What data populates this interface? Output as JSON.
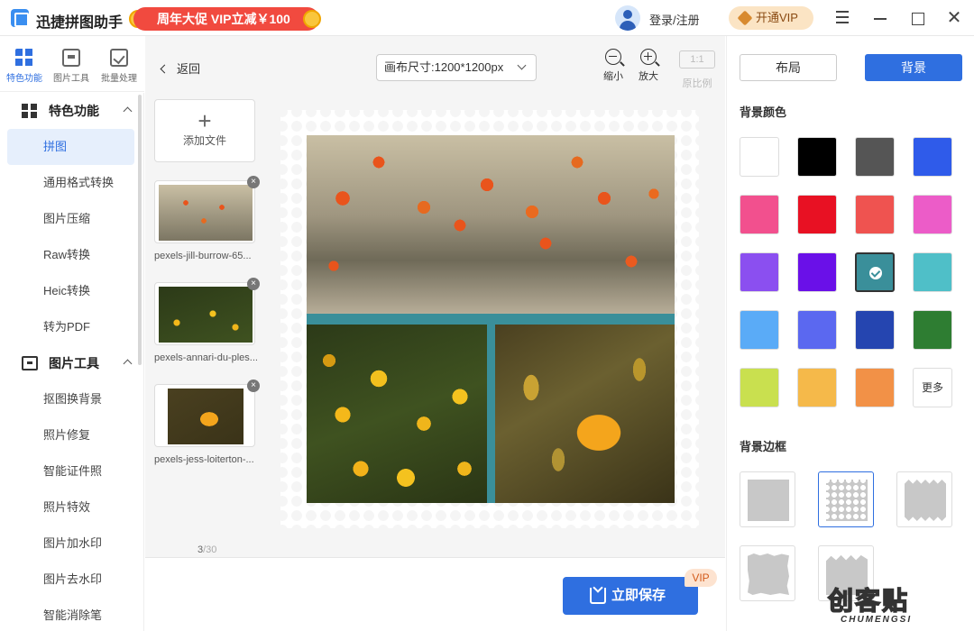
{
  "app": {
    "title": "迅捷拼图助手"
  },
  "promo": {
    "text": "周年大促 VIP立减￥100"
  },
  "header": {
    "login": "登录/注册",
    "vip_button": "开通VIP"
  },
  "rail": [
    {
      "label": "特色功能",
      "icon": "feature-grid-icon"
    },
    {
      "label": "图片工具",
      "icon": "image-tool-icon"
    },
    {
      "label": "批量处理",
      "icon": "batch-process-icon"
    }
  ],
  "sidebar": {
    "sections": [
      {
        "title": "特色功能",
        "items": [
          "拼图",
          "通用格式转换",
          "图片压缩",
          "Raw转换",
          "Heic转换",
          "转为PDF"
        ]
      },
      {
        "title": "图片工具",
        "items": [
          "抠图换背景",
          "照片修复",
          "智能证件照",
          "照片特效",
          "图片加水印",
          "图片去水印",
          "智能消除笔"
        ]
      }
    ],
    "active_item": "拼图"
  },
  "toolbar": {
    "back": "返回",
    "canvas_size": "画布尺寸:1200*1200px",
    "zoom_out": "缩小",
    "zoom_in": "放大",
    "ratio_box": "1:1",
    "ratio_label": "原比例"
  },
  "files": {
    "add_label": "添加文件",
    "items": [
      {
        "name": "pexels-jill-burrow-65..."
      },
      {
        "name": "pexels-annari-du-ples..."
      },
      {
        "name": "pexels-jess-loiterton-..."
      }
    ],
    "count": "3",
    "total": "/30"
  },
  "save": {
    "button": "立即保存",
    "vip_tag": "VIP"
  },
  "right_panel": {
    "tabs": {
      "layout": "布局",
      "background": "背景"
    },
    "bg_color_title": "背景颜色",
    "swatches": [
      "#ffffff",
      "#000000",
      "#555555",
      "#2f5bea",
      "#f2508e",
      "#e81123",
      "#ef5350",
      "#ec5cc8",
      "#8b4ff0",
      "#6a10e8",
      "#3a8f9a",
      "#4fbfc8",
      "#5aabf7",
      "#5b68f0",
      "#2545b0",
      "#2e7d32",
      "#c9e04f",
      "#f5b94a",
      "#f29147"
    ],
    "selected_swatch": 10,
    "more_label": "更多",
    "border_title": "背景边框"
  },
  "watermark": {
    "main": "创客贴",
    "sub": "CHUMENGSI"
  }
}
